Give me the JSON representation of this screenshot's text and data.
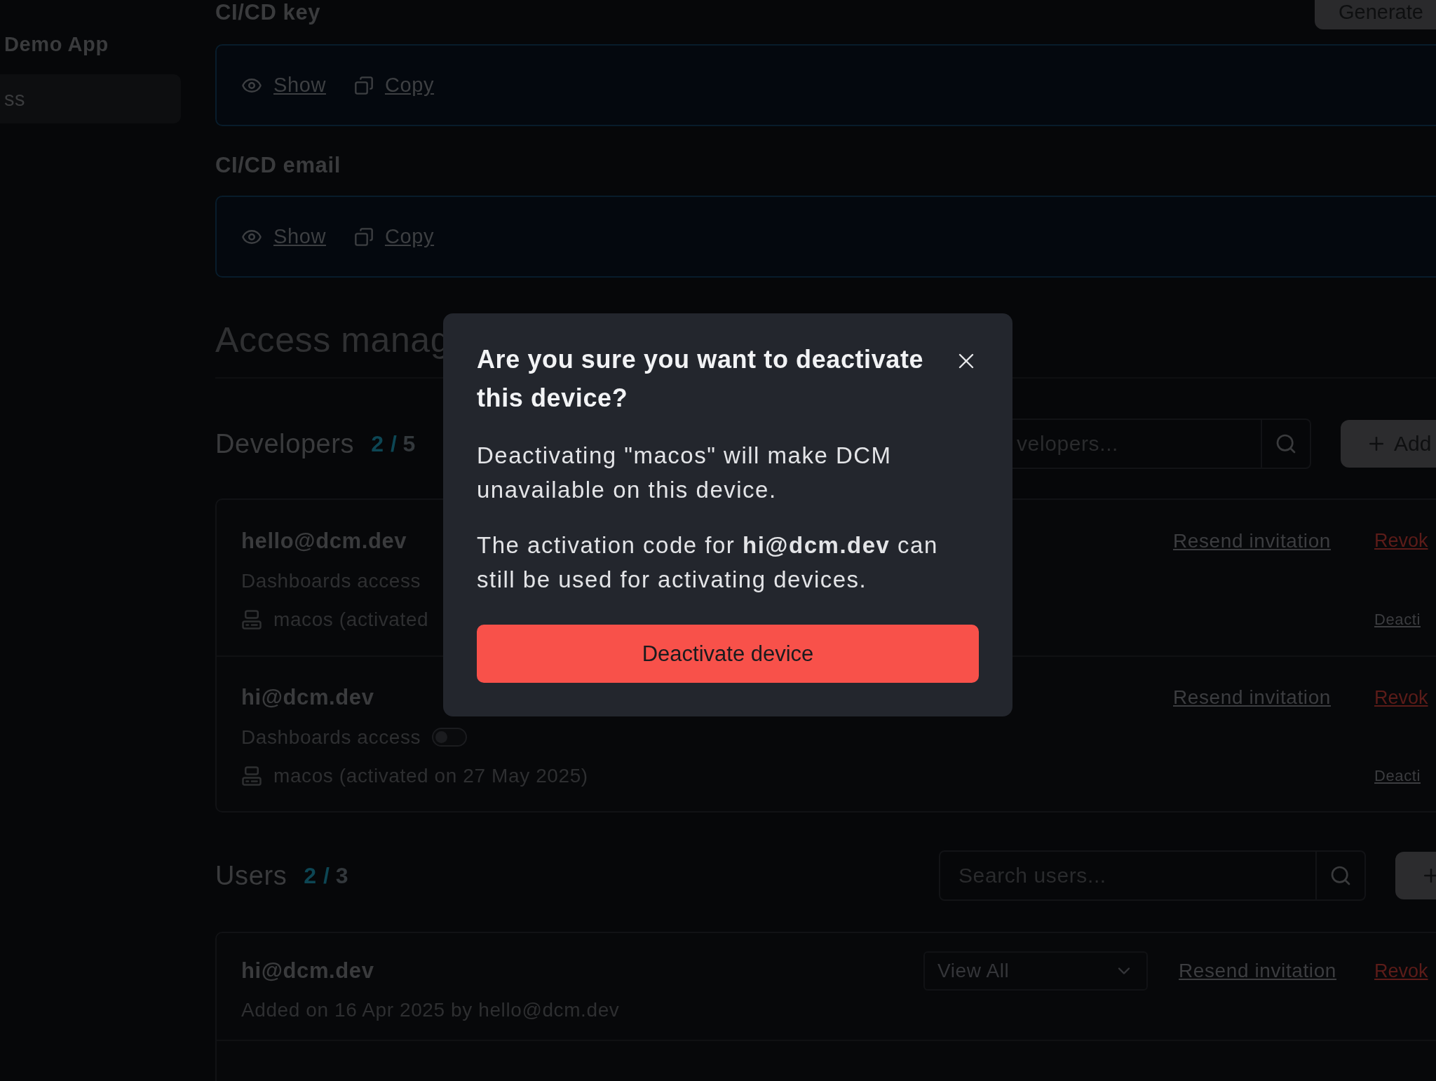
{
  "sidebar": {
    "items": [
      {
        "label": "Demo App",
        "selected": false
      },
      {
        "label": "ss",
        "selected": true
      }
    ]
  },
  "generate_button": "Generate",
  "credentials": [
    {
      "title": "CI/CD key",
      "actions": [
        {
          "kind": "show",
          "label": "Show"
        },
        {
          "kind": "copy",
          "label": "Copy"
        }
      ]
    },
    {
      "title": "CI/CD email",
      "actions": [
        {
          "kind": "show",
          "label": "Show"
        },
        {
          "kind": "copy",
          "label": "Copy"
        }
      ]
    }
  ],
  "access_heading": "Access manag",
  "developers": {
    "title": "Developers",
    "count": "2 /",
    "total": "5",
    "search_placeholder": "velopers...",
    "add_button": "Add",
    "members": [
      {
        "email": "hello@dcm.dev",
        "access_label": "Dashboards access",
        "device": "macos (activated",
        "resend": "Resend invitation",
        "revoke": "Revok",
        "deactivate": "Deacti"
      },
      {
        "email": "hi@dcm.dev",
        "access_label": "Dashboards access",
        "access_toggle": {
          "on": false
        },
        "device": "macos (activated on 27 May 2025)",
        "resend": "Resend invitation",
        "revoke": "Revok",
        "deactivate": "Deacti"
      }
    ]
  },
  "users": {
    "title": "Users",
    "count": "2 /",
    "total": "3",
    "search_placeholder": "Search users...",
    "members": [
      {
        "email": "hi@dcm.dev",
        "added": "Added on 16 Apr 2025 by hello@dcm.dev",
        "role": "View All",
        "resend": "Resend invitation",
        "revoke": "Revok"
      }
    ]
  },
  "modal": {
    "title": "Are you sure you want to deactivate this device?",
    "paragraphs": [
      "Deactivating \"macos\" will make DCM unavailable on this device.",
      "The activation code for **hi@dcm.dev** can still be used for activating devices."
    ],
    "confirm_button": "Deactivate device"
  }
}
